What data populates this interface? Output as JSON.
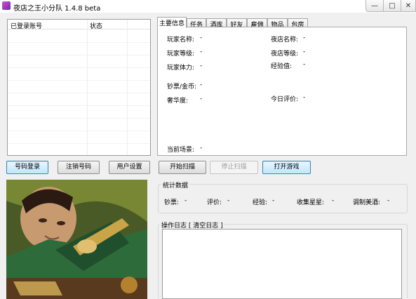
{
  "window": {
    "title": "夜店之王小分队 1.4.8 beta",
    "min_glyph": "—",
    "max_glyph": "□",
    "close_glyph": "✕"
  },
  "accounts": {
    "columns": [
      "已登录账号",
      "状态"
    ]
  },
  "tabs": [
    "主要信息",
    "任务",
    "酒库",
    "好友",
    "雇佣",
    "物品",
    "包房"
  ],
  "info": {
    "player_name_label": "玩家名称:",
    "player_name_value": "-",
    "player_level_label": "玩家等级:",
    "player_level_value": "-",
    "player_stamina_label": "玩家体力:",
    "player_stamina_value": "-",
    "cash_gold_label": "钞票/金币:",
    "cash_gold_value": "-",
    "luxury_label": "奢华度:",
    "luxury_value": "-",
    "store_name_label": "夜店名称:",
    "store_name_value": "-",
    "store_level_label": "夜店等级:",
    "store_level_value": "-",
    "experience_label": "经验值:",
    "experience_value": "-",
    "today_rating_label": "今日评价:",
    "today_rating_value": "-",
    "current_scene_label": "当前场景:",
    "current_scene_value": "-"
  },
  "buttons": {
    "login": "号码登录",
    "logout": "注销号码",
    "user_settings": "用户设置",
    "start_scan": "开始扫描",
    "stop_scan": "停止扫描",
    "open_game": "打开游戏"
  },
  "stats": {
    "title": "统计数据",
    "cash_label": "钞票:",
    "cash_value": "-",
    "rating_label": "评价:",
    "rating_value": "-",
    "exp_label": "经验:",
    "exp_value": "-",
    "stars_label": "收集星星:",
    "stars_value": "-",
    "cocktail_label": "调制美酒:",
    "cocktail_value": "-"
  },
  "log": {
    "title": "操作日志 [ 清空日志 ]"
  }
}
